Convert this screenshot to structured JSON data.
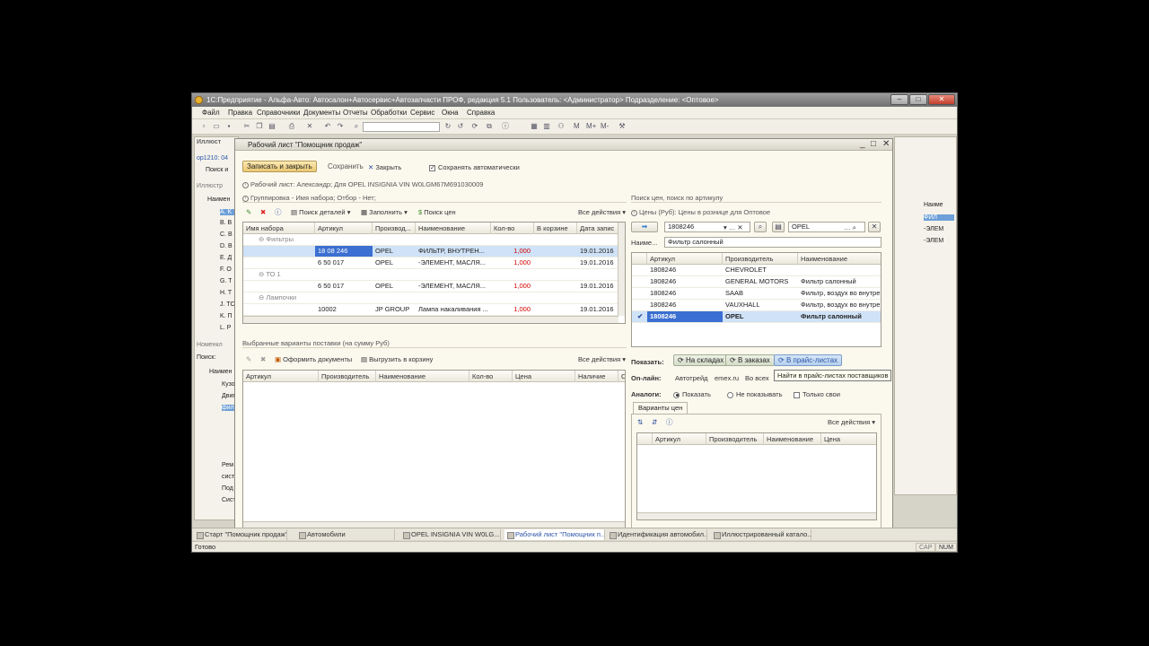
{
  "window": {
    "title": "1С:Предприятие - Альфа-Авто: Автосалон+Автосервис+Автозапчасти ПРОФ, редакция 5.1    Пользователь: <Администратор>    Подразделение: <Оптовое>"
  },
  "menu": [
    "Файл",
    "Правка",
    "Справочники",
    "Документы",
    "Отчеты",
    "Обработки",
    "Сервис",
    "Окна",
    "Справка"
  ],
  "toolbar": {
    "m_labels": [
      "M",
      "M+",
      "M-"
    ]
  },
  "bg_window": {
    "title": "Иллюст",
    "code": "ор1210: 04",
    "tab": "Поиск и",
    "label": "Иллюстр",
    "col": "Наимен",
    "rows": [
      "A. K",
      "B. B",
      "C. B",
      "D. B",
      "E. Д",
      "F. O",
      "G. T",
      "H. T",
      "J. TC",
      "K. П",
      "L. P"
    ],
    "section2": "Номенкл",
    "search_label": "Поиск:",
    "col2": "Наимен",
    "tree": [
      "Кузо",
      "Двиг",
      "фил",
      "",
      "",
      "",
      "Рем",
      "сист",
      "Под",
      "Сист"
    ]
  },
  "bg_right": {
    "col": "Наиме",
    "rows": [
      "ФИЛ",
      "-ЭЛЕМ",
      "-ЭЛЕМ"
    ]
  },
  "dialog": {
    "title": "Рабочий лист \"Помощник продаж\"",
    "btn_save_close": "Записать и закрыть",
    "btn_save": "Сохранить",
    "btn_close": "Закрыть",
    "autosave_label": "Сохранять автоматически",
    "worksheet_info": "Рабочий лист: Александр;  Для OPEL INSIGNIA VIN W0LGM67M691030009",
    "grouping_info": "Группировка - Имя набора; Отбор - Нет;",
    "left_toolbar": {
      "search_parts": "Поиск деталей",
      "fill": "Заполнить",
      "search_prices": "Поиск цен",
      "all_actions": "Все действия"
    },
    "left_grid": {
      "headers": [
        "Имя набора",
        "Артикул",
        "Производ...",
        "Наименование",
        "Кол-во",
        "В корзине",
        "Дата запис"
      ],
      "rows": [
        {
          "set": "Фильтры",
          "art": "",
          "mfr": "",
          "name": "",
          "qty": "",
          "cart": "",
          "date": "",
          "group": true
        },
        {
          "set": "",
          "art": "18 08 246",
          "mfr": "OPEL",
          "name": "ФИЛЬТР, ВНУТРЕН...",
          "qty": "1,000",
          "cart": "",
          "date": "19.01.2016",
          "selected": true
        },
        {
          "set": "",
          "art": "6 50 017",
          "mfr": "OPEL",
          "name": "-ЭЛЕМЕНТ, МАСЛЯ...",
          "qty": "1,000",
          "cart": "",
          "date": "19.01.2016"
        },
        {
          "set": "ТО 1",
          "art": "",
          "mfr": "",
          "name": "",
          "qty": "",
          "cart": "",
          "date": "",
          "group": true
        },
        {
          "set": "",
          "art": "6 50 017",
          "mfr": "OPEL",
          "name": "-ЭЛЕМЕНТ, МАСЛЯ...",
          "qty": "1,000",
          "cart": "",
          "date": "19.01.2016"
        },
        {
          "set": "Лампочки",
          "art": "",
          "mfr": "",
          "name": "",
          "qty": "",
          "cart": "",
          "date": "",
          "group": true
        },
        {
          "set": "",
          "art": "10002",
          "mfr": "JP GROUP",
          "name": "Лампа накаливания ...",
          "qty": "1,000",
          "cart": "",
          "date": "19.01.2016"
        }
      ]
    },
    "supply_info": "Выбранные варианты поставки (на сумму  Руб)",
    "supply_toolbar": {
      "make_docs": "Оформить документы",
      "to_cart": "Выгрузить в корзину",
      "all_actions": "Все действия"
    },
    "supply_grid": {
      "headers": [
        "Артикул",
        "Производитель",
        "Наименование",
        "Кол-во",
        "Цена",
        "Наличие",
        "Се"
      ]
    },
    "right": {
      "section": "Поиск цен, поиск по артикулу",
      "prices_info": "Цены (Руб): Цены в рознице для Оптовое",
      "article_value": "1808246",
      "mfr_value": "OPEL",
      "name_label": "Наиме...",
      "name_value": "Фильтр салонный",
      "grid_headers": [
        "Артикул",
        "Производитель",
        "Наименование"
      ],
      "rows": [
        {
          "art": "1808246",
          "mfr": "CHEVROLET",
          "name": ""
        },
        {
          "art": "1808246",
          "mfr": "GENERAL MOTORS",
          "name": "Фильтр салонный"
        },
        {
          "art": "1808246",
          "mfr": "SAAB",
          "name": "Фильтр, воздух во внутре..."
        },
        {
          "art": "1808246",
          "mfr": "VAUXHALL",
          "name": "Фильтр, воздух во внутре..."
        },
        {
          "art": "1808246",
          "mfr": "OPEL",
          "name": "Фильтр салонный",
          "selected": true
        }
      ],
      "show_label": "Показать:",
      "btn_warehouse": "На складах",
      "btn_orders": "В заказах",
      "btn_pricelists": "В прайс-листах",
      "tooltip": "Найти в прайс-листах поставщиков",
      "online_label": "On-лайн:",
      "online_links": [
        "Автотрейд",
        "emex.ru",
        "Во всех"
      ],
      "analogs_label": "Аналоги:",
      "opt_show": "Показать",
      "opt_hide": "Не показывать",
      "opt_only": "Только свои",
      "tab_variants": "Варианты цен",
      "all_actions": "Все действия",
      "variants_headers": [
        "Артикул",
        "Производитель",
        "Наименование",
        "Цена"
      ]
    }
  },
  "taskbar": [
    "Старт \"Помощник продаж\"",
    "Автомобили",
    "OPEL INSIGNIA VIN W0LG...",
    "Рабочий лист \"Помощник п...",
    "Идентификация автомобил...",
    "Иллюстрированный катало..."
  ],
  "status": {
    "text": "Готово",
    "caps": "CAP",
    "num": "NUM"
  }
}
